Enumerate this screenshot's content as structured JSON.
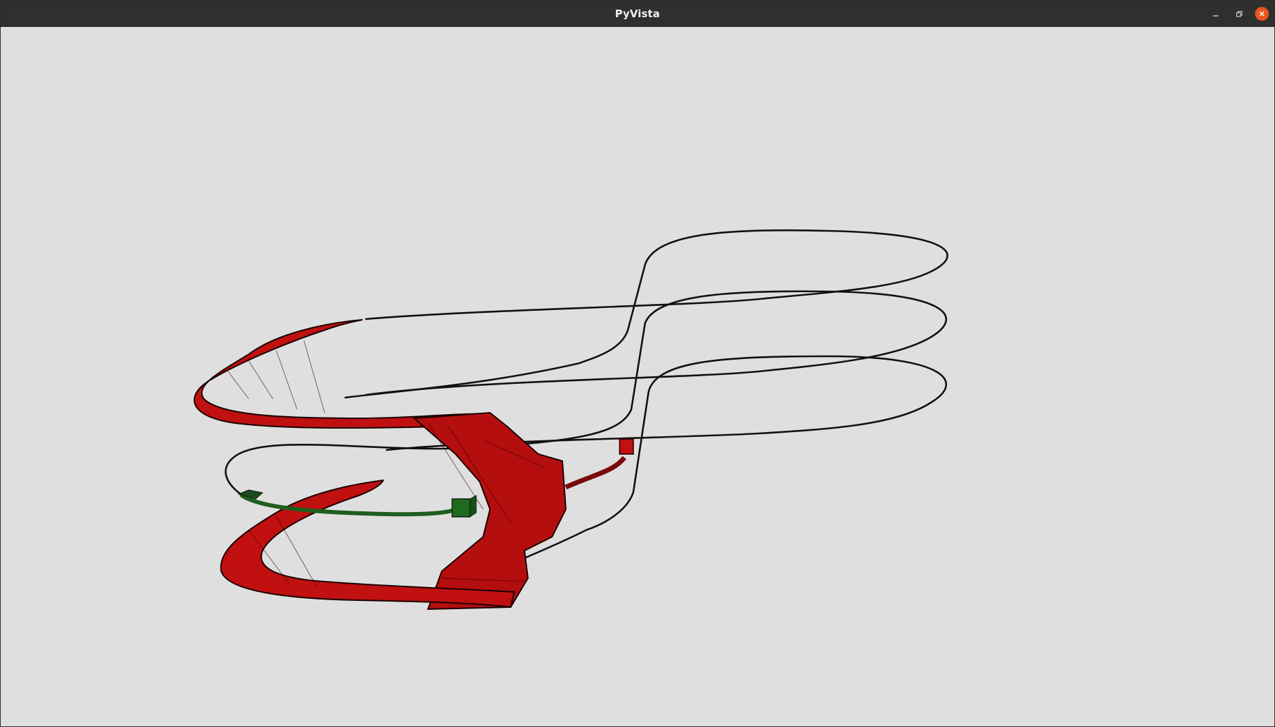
{
  "window": {
    "title": "PyVista"
  },
  "titlebar_controls": {
    "minimize": "minimize-icon",
    "restore": "restore-icon",
    "close": "close-icon"
  },
  "scene": {
    "background_color": "#dfdfdf",
    "objects": [
      {
        "name": "red-helix-mesh",
        "color": "#c01010"
      },
      {
        "name": "green-tube-mesh",
        "color": "#1e7a1e"
      },
      {
        "name": "black-helix-curve",
        "color": "#000000"
      }
    ]
  }
}
